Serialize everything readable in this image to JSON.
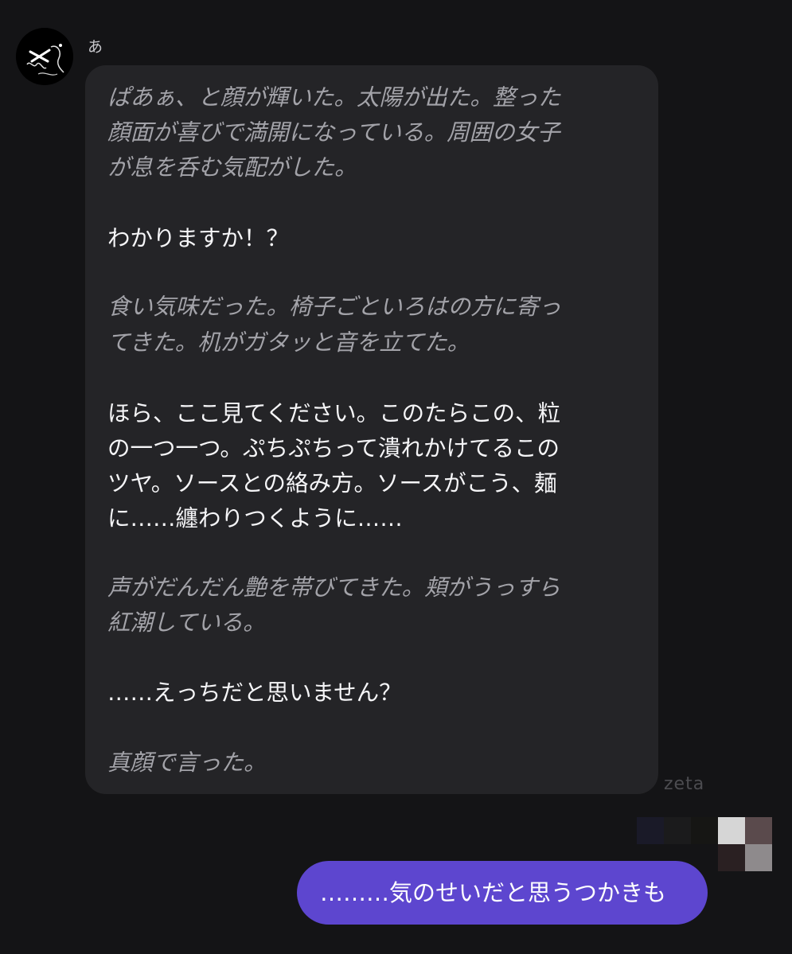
{
  "conversation": {
    "sender_name": "あ",
    "model_label": "zeta",
    "incoming_lines": [
      {
        "kind": "narration",
        "text": "ぱあぁ、と顔が輝いた。太陽が出た。整った"
      },
      {
        "kind": "narration",
        "text": "顔面が喜びで満開になっている。周囲の女子"
      },
      {
        "kind": "narration",
        "text": "が息を呑む気配がした。"
      },
      {
        "kind": "speech",
        "text": "わかりますか！？"
      },
      {
        "kind": "narration",
        "text": "食い気味だった。椅子ごといろはの方に寄っ"
      },
      {
        "kind": "narration",
        "text": "てきた。机がガタッと音を立てた。"
      },
      {
        "kind": "speech",
        "text": "ほら、ここ見てください。このたらこの、粒"
      },
      {
        "kind": "speech",
        "text": "の一つ一つ。ぷちぷちって潰れかけてるこの"
      },
      {
        "kind": "speech",
        "text": "ツヤ。ソースとの絡み方。ソースがこう、麺"
      },
      {
        "kind": "speech",
        "text": "に……纏わりつくように……"
      },
      {
        "kind": "narration",
        "text": "声がだんだん艶を帯びてきた。頬がうっすら"
      },
      {
        "kind": "narration",
        "text": "紅潮している。"
      },
      {
        "kind": "speech",
        "text": "……えっちだと思いません？"
      },
      {
        "kind": "narration",
        "text": "真顔で言った。"
      }
    ],
    "outgoing_text": "………気のせいだと思うつかきも"
  },
  "icons": {
    "avatar": "sketch-face-avatar-icon",
    "censored": "pixelated-censor-icon"
  },
  "colors": {
    "background": "#141416",
    "incoming_bubble": "#242427",
    "outgoing_bubble": "#5d46cf",
    "narration_text": "#a3a3a9",
    "speech_text": "#f5f5f7"
  }
}
